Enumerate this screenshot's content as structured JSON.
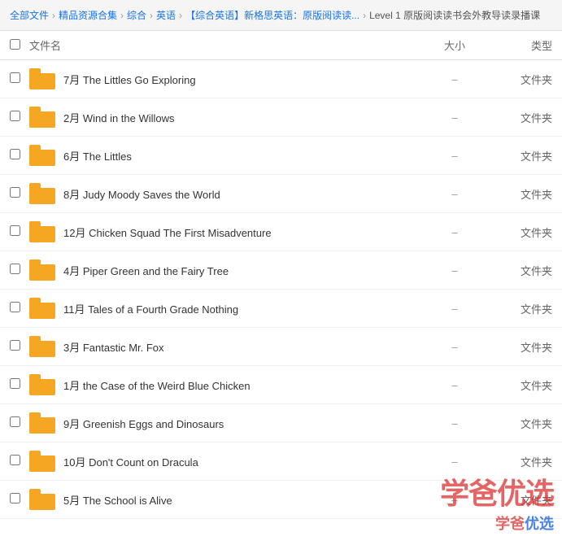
{
  "breadcrumb": {
    "items": [
      {
        "label": "全部文件"
      },
      {
        "label": "精品资源合集"
      },
      {
        "label": "综合"
      },
      {
        "label": "英语"
      },
      {
        "label": "【综合英语】新格思英语：原版阅读读..."
      },
      {
        "label": "Level 1 原版阅读读书会外教导读录播课"
      }
    ]
  },
  "table": {
    "headers": {
      "name": "文件名",
      "size": "大小",
      "type": "类型"
    },
    "rows": [
      {
        "name": "7月 The Littles Go Exploring",
        "size": "–",
        "type": "文件夹"
      },
      {
        "name": "2月 Wind in the Willows",
        "size": "–",
        "type": "文件夹"
      },
      {
        "name": "6月 The Littles",
        "size": "–",
        "type": "文件夹"
      },
      {
        "name": "8月 Judy Moody Saves the World",
        "size": "–",
        "type": "文件夹"
      },
      {
        "name": "12月 Chicken Squad The First Misadventure",
        "size": "–",
        "type": "文件夹"
      },
      {
        "name": "4月 Piper Green and the Fairy Tree",
        "size": "–",
        "type": "文件夹"
      },
      {
        "name": "11月 Tales of a Fourth Grade Nothing",
        "size": "–",
        "type": "文件夹"
      },
      {
        "name": "3月 Fantastic Mr. Fox",
        "size": "–",
        "type": "文件夹"
      },
      {
        "name": "1月 the Case of the Weird Blue Chicken",
        "size": "–",
        "type": "文件夹"
      },
      {
        "name": "9月 Greenish Eggs and Dinosaurs",
        "size": "–",
        "type": "文件夹"
      },
      {
        "name": "10月 Don't Count on Dracula",
        "size": "–",
        "type": "文件夹"
      },
      {
        "name": "5月 The School is Alive",
        "size": "–",
        "type": "文件夹"
      }
    ]
  },
  "watermark": {
    "line1": "学爸优选",
    "line2_part1": "学爸",
    "line2_part2": "优选"
  }
}
